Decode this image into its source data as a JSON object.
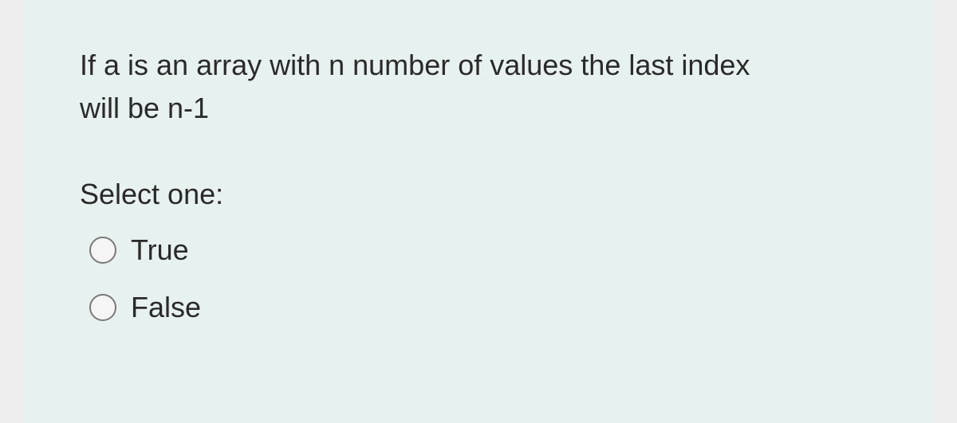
{
  "question": {
    "text": "If a is an array with n number of values the last index will be n-1",
    "prompt": "Select one:",
    "options": [
      {
        "label": "True"
      },
      {
        "label": "False"
      }
    ]
  }
}
